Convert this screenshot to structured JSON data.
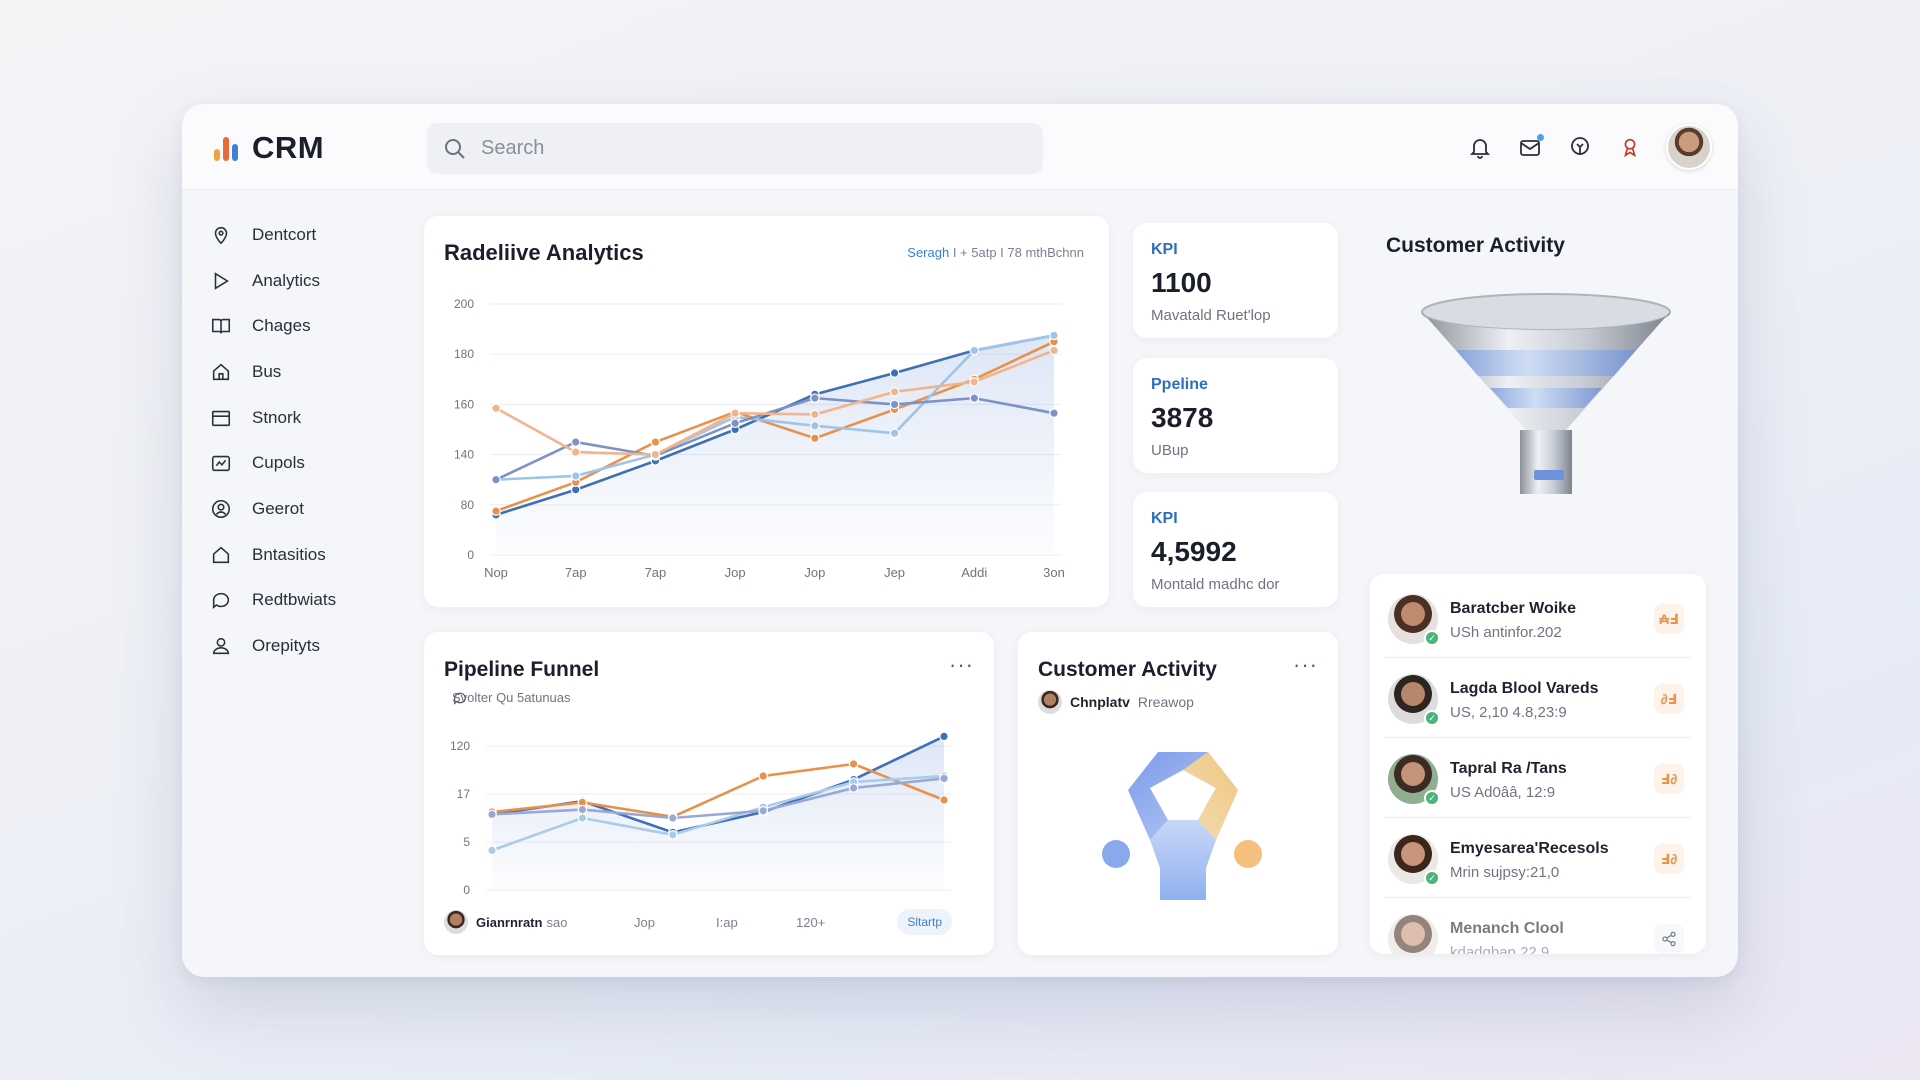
{
  "app": {
    "title": "CRM"
  },
  "search": {
    "placeholder": "Search"
  },
  "sidebar": {
    "items": [
      {
        "label": "Dentcort",
        "icon": "location-icon"
      },
      {
        "label": "Analytics",
        "icon": "play-icon"
      },
      {
        "label": "Chages",
        "icon": "book-icon"
      },
      {
        "label": "Bus",
        "icon": "home-icon"
      },
      {
        "label": "Stnork",
        "icon": "calendar-icon"
      },
      {
        "label": "Cupols",
        "icon": "chart-card-icon"
      },
      {
        "label": "Geerot",
        "icon": "user-circle-icon"
      },
      {
        "label": "Bntasitios",
        "icon": "house-icon"
      },
      {
        "label": "Redtbwiats",
        "icon": "chat-icon"
      },
      {
        "label": "Orepityts",
        "icon": "person-icon"
      }
    ]
  },
  "analytics": {
    "title": "Radeliive Analytics",
    "note_accent": "Seragh",
    "note_rest": "I + 5atp I 78 mthBchnn"
  },
  "kpis": [
    {
      "label": "KPI",
      "value": "1100",
      "sub": "Mavatald Ruet'lop"
    },
    {
      "label": "Ppeline",
      "value": "3878",
      "sub": "UBup"
    },
    {
      "label": "KPI",
      "value": "4,5992",
      "sub": "Montald madhc dor"
    }
  ],
  "funnel_card": {
    "title": "Customer Activity"
  },
  "people": [
    {
      "name": "Baratcber Woike",
      "detail": "USh antinfor.202",
      "action": "₳Ⅎ"
    },
    {
      "name": "Lagda Blool Vareds",
      "detail": "US, 2,10 4.8,23:9",
      "action": "∂Ⅎ"
    },
    {
      "name": "Tapral Ra /Tans",
      "detail": "US Ad0ââ, 12:9",
      "action": "Ⅎ∂"
    },
    {
      "name": "Emyesarea'Recesols",
      "detail": "Mrin sujpsy:21,0",
      "action": "Ⅎ∂"
    },
    {
      "name": "Menanch Clool",
      "detail": "kdadgbap,22,9",
      "action": "share"
    }
  ],
  "pipeline": {
    "title": "Pipeline Funnel",
    "subtitle": "Svolter Qu 5atunuas",
    "footer_name": "Gianrnratn",
    "footer_suffix": "sao",
    "footer_labels": [
      "Jop",
      "I:ap",
      "120+"
    ],
    "start_label": "Sltartp"
  },
  "activity": {
    "title": "Customer Activity",
    "user_bold": "Chnplatv",
    "user_rest": "Rreawop"
  },
  "chart_data": [
    {
      "type": "line",
      "title": "Radeliive Analytics",
      "x": [
        "Nop",
        "7ap",
        "7ap",
        "Jop",
        "Jop",
        "Jep",
        "Addi",
        "3on"
      ],
      "yticks": [
        "200",
        "180",
        "160",
        "140",
        "80",
        "0"
      ],
      "ylim": [
        0,
        200
      ],
      "series": [
        {
          "color": "#3f6fb5",
          "values": [
            32,
            52,
            75,
            100,
            128,
            145,
            163,
            175
          ]
        },
        {
          "color": "#e8914a",
          "values": [
            35,
            58,
            90,
            114,
            93,
            116,
            140,
            170
          ]
        },
        {
          "color": "#9fc4e9",
          "values": [
            60,
            63,
            80,
            110,
            103,
            97,
            163,
            175
          ]
        },
        {
          "color": "#7d93c8",
          "values": [
            60,
            90,
            79,
            105,
            125,
            120,
            125,
            113
          ]
        },
        {
          "color": "#f2b48c",
          "values": [
            117,
            82,
            80,
            113,
            112,
            130,
            138,
            163
          ]
        }
      ],
      "grid": true
    },
    {
      "type": "line",
      "title": "Pipeline Funnel",
      "yticks": [
        "120",
        "17",
        "5",
        "0"
      ],
      "ylim": [
        0,
        120
      ],
      "series": [
        {
          "color": "#3f6fb5",
          "values": [
            63,
            74,
            48,
            65,
            92,
            128
          ]
        },
        {
          "color": "#e8914a",
          "values": [
            65,
            73,
            61,
            95,
            105,
            75
          ]
        },
        {
          "color": "#a9cbec",
          "values": [
            33,
            60,
            46,
            69,
            90,
            95
          ]
        },
        {
          "color": "#9aa8d6",
          "values": [
            63,
            67,
            60,
            66,
            85,
            93
          ]
        }
      ],
      "grid": true
    }
  ]
}
